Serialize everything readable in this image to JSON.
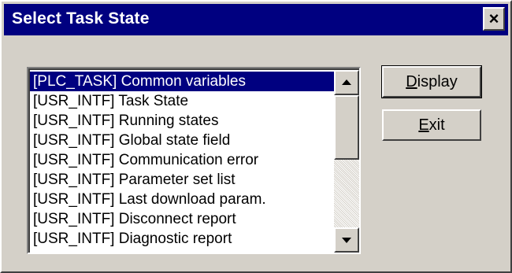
{
  "window": {
    "title": "Select Task State",
    "close_glyph": "×"
  },
  "list": {
    "items": [
      {
        "label": "[PLC_TASK] Common variables",
        "selected": true
      },
      {
        "label": "[USR_INTF] Task State",
        "selected": false
      },
      {
        "label": "[USR_INTF] Running states",
        "selected": false
      },
      {
        "label": "[USR_INTF] Global state field",
        "selected": false
      },
      {
        "label": "[USR_INTF] Communication error",
        "selected": false
      },
      {
        "label": "[USR_INTF] Parameter set list",
        "selected": false
      },
      {
        "label": "[USR_INTF] Last download param.",
        "selected": false
      },
      {
        "label": "[USR_INTF] Disconnect report",
        "selected": false
      },
      {
        "label": "[USR_INTF] Diagnostic report",
        "selected": false
      }
    ],
    "scroll_up_icon": "arrow-up-icon",
    "scroll_down_icon": "arrow-down-icon"
  },
  "buttons": {
    "display": {
      "mnemonic": "D",
      "rest": "isplay"
    },
    "exit": {
      "mnemonic": "E",
      "rest": "xit"
    }
  },
  "colors": {
    "titlebar": "#000080",
    "selection": "#000080",
    "face": "#d4d0c8"
  }
}
